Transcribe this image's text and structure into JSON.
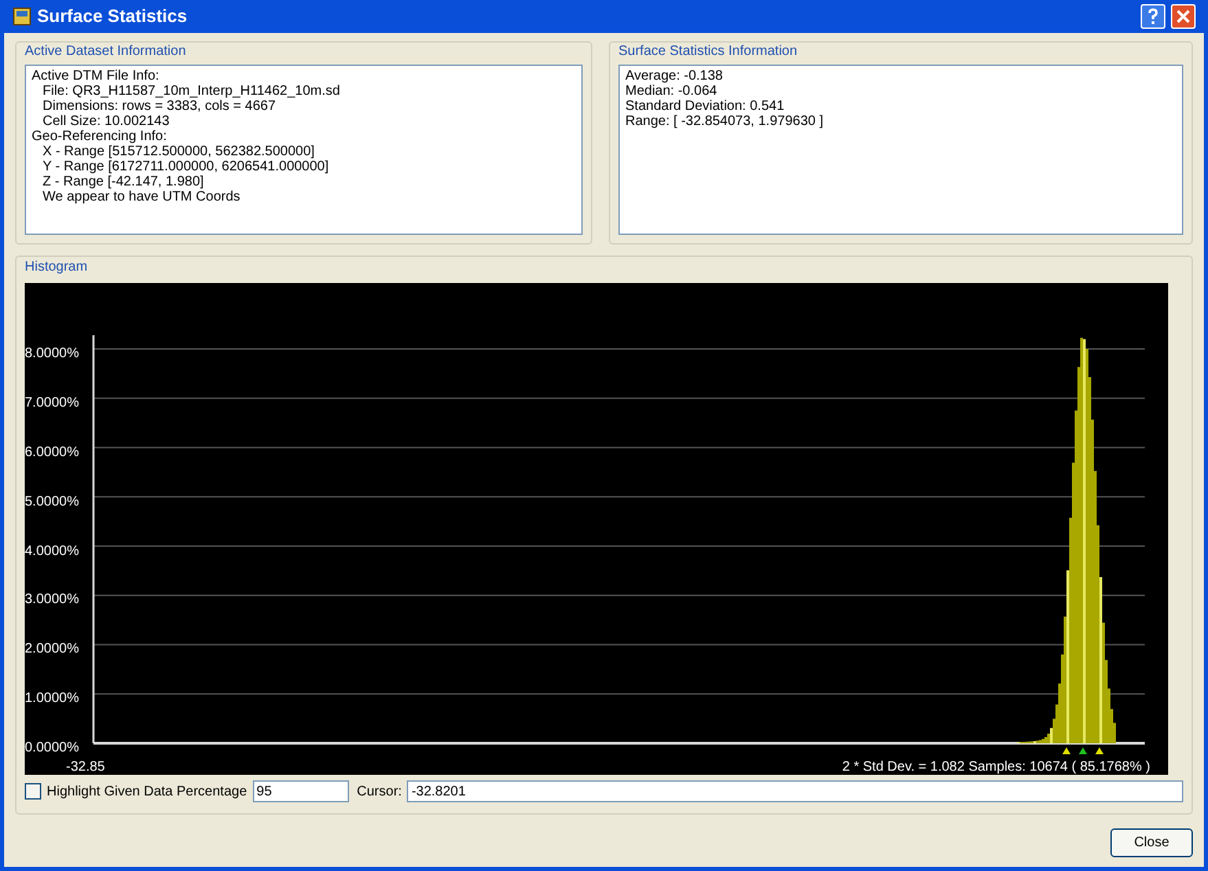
{
  "window": {
    "title": "Surface Statistics"
  },
  "dataset_info": {
    "title": "Active Dataset Information",
    "lines": [
      {
        "text": "Active DTM File Info:",
        "indent": false
      },
      {
        "text": "File: QR3_H11587_10m_Interp_H11462_10m.sd",
        "indent": true
      },
      {
        "text": "Dimensions: rows = 3383, cols = 4667",
        "indent": true
      },
      {
        "text": "Cell Size: 10.002143",
        "indent": true
      },
      {
        "text": "Geo-Referencing Info:",
        "indent": false
      },
      {
        "text": "X - Range [515712.500000, 562382.500000]",
        "indent": true
      },
      {
        "text": "Y - Range [6172711.000000, 6206541.000000]",
        "indent": true
      },
      {
        "text": "Z - Range [-42.147, 1.980]",
        "indent": true
      },
      {
        "text": "We appear to have UTM Coords",
        "indent": true
      }
    ]
  },
  "statistics_info": {
    "title": "Surface Statistics Information",
    "lines": [
      "Average: -0.138",
      "Median: -0.064",
      "Standard Deviation: 0.541",
      "Range: [ -32.854073, 1.979630 ]"
    ]
  },
  "histogram": {
    "title": "Histogram",
    "y_tick_labels": [
      "8.0000%",
      "7.0000%",
      "6.0000%",
      "5.0000%",
      "4.0000%",
      "3.0000%",
      "2.0000%",
      "1.0000%",
      "0.0000%"
    ],
    "x_label": "-32.85",
    "summary": "2 * Std Dev. = 1.082 Samples: 10674 ( 85.1768% )"
  },
  "highlight": {
    "label": "Highlight Given Data Percentage",
    "checked": false,
    "percentage": "95"
  },
  "cursor": {
    "label": "Cursor:",
    "value": "-32.8201"
  },
  "buttons": [
    "Close"
  ]
}
